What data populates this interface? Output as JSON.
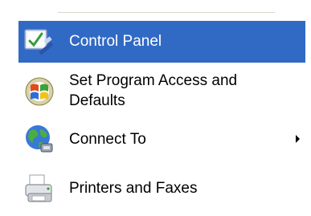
{
  "menu": {
    "items": [
      {
        "label": "Control Panel",
        "icon": "control-panel-icon",
        "selected": true
      },
      {
        "label_line1": "Set Program Access and",
        "label_line2": "Defaults",
        "icon": "set-program-access-icon",
        "selected": false
      },
      {
        "label": "Connect To",
        "icon": "connect-to-icon",
        "selected": false,
        "has_submenu": true
      },
      {
        "label": "Printers and Faxes",
        "icon": "printers-and-faxes-icon",
        "selected": false
      }
    ]
  },
  "colors": {
    "selection_background": "#316ac5",
    "selection_text": "#ffffff",
    "text": "#000000",
    "separator": "#d9d7d0"
  }
}
